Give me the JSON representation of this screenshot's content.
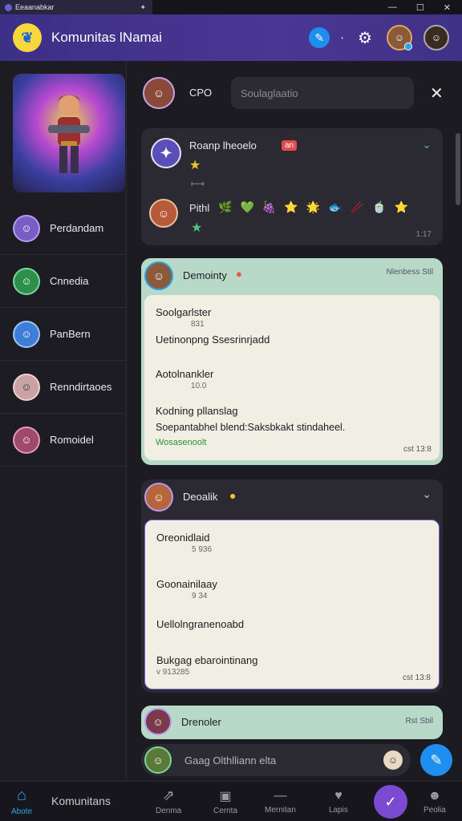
{
  "window": {
    "app_title": "Eeaanabkar",
    "controls": [
      "—",
      "☐",
      "✕"
    ]
  },
  "header": {
    "title": "Komunitas lNamai",
    "logo_icon": "feather-logo-icon",
    "accent": "#4a3794"
  },
  "sidebar": {
    "items": [
      {
        "label": "Perdandam",
        "avatar_color": "#7a5cc7"
      },
      {
        "label": "Cnnedia",
        "avatar_color": "#2c8f4a"
      },
      {
        "label": "PanBern",
        "avatar_color": "#3f7ed6"
      },
      {
        "label": "Renndirtaoes",
        "avatar_color": "#caa2a2"
      },
      {
        "label": "Romoidel",
        "avatar_color": "#a04a6a"
      }
    ]
  },
  "main": {
    "search": {
      "label": "CPO",
      "placeholder": "Soulaglaatio"
    },
    "cards": [
      {
        "title": "Roanp lheoelo",
        "badge": "an",
        "sub_label": "Pithl",
        "reactions": [
          "🌿",
          "💚",
          "🍇",
          "⭐",
          "🌟",
          "🐟",
          "🥢",
          "🍵",
          "⭐"
        ],
        "time": "1:17"
      },
      {
        "title": "Demointy",
        "meta": "Nlenbess Stil",
        "posts": [
          {
            "title": "Soolgarlster",
            "sub": "831"
          },
          {
            "title": "Uetinonpng Ssesrinrjadd",
            "sub": ""
          },
          {
            "title": "Aotolnankler",
            "sub": "10.0"
          },
          {
            "title": "Kodning pllanslag",
            "sub": ""
          },
          {
            "title": "Soepantabhel blend:Saksbkakt  stindaheel.",
            "sub": ""
          }
        ],
        "tag": "Wosasenoolt",
        "time": "cst 13:8"
      },
      {
        "title": "Deoalik",
        "posts": [
          {
            "title": "Oreonidlaid",
            "sub": "5 936"
          },
          {
            "title": "Goonainilaay",
            "sub": "9 34"
          },
          {
            "title": "Uellolngranenoabd",
            "sub": ""
          },
          {
            "title": "Bukgag ebarointinang",
            "sub": "v 913285"
          }
        ],
        "time": "cst 13:8"
      },
      {
        "title": "Drenoler",
        "meta": "Rst Sbil"
      }
    ],
    "compose_placeholder": "Gaag Olthlliann elta"
  },
  "bottom_nav": [
    {
      "label": "Abote",
      "icon": "home-icon",
      "active": true
    },
    {
      "label": "Komunitans",
      "icon": "",
      "active": false
    },
    {
      "label": "Denma",
      "icon": "share-icon",
      "active": false
    },
    {
      "label": "Cernta",
      "icon": "inbox-icon",
      "active": false
    },
    {
      "label": "Mernitan",
      "icon": "dash-icon",
      "active": false
    },
    {
      "label": "Lapis",
      "icon": "heart-icon",
      "active": false
    },
    {
      "label": "",
      "icon": "check-circle-icon",
      "active": false
    },
    {
      "label": "Peolia",
      "icon": "profile-icon",
      "active": false
    }
  ]
}
